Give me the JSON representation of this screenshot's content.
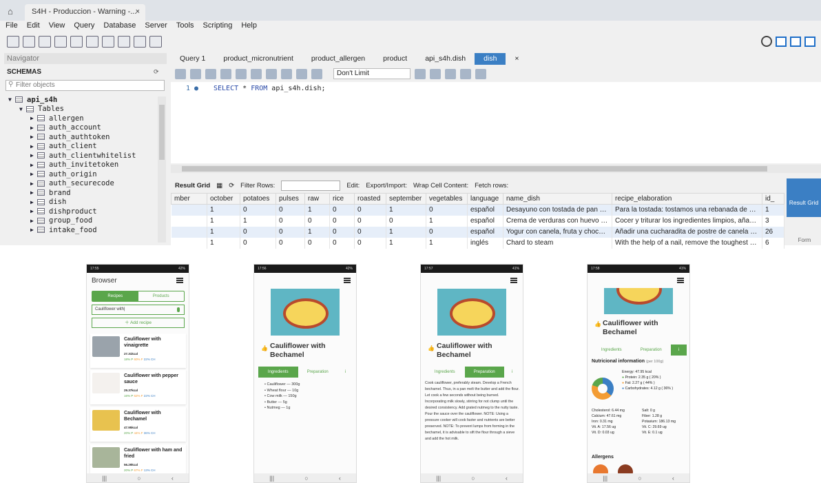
{
  "workbench": {
    "window_tab": "S4H - Produccion - Warning -...",
    "menu": [
      "File",
      "Edit",
      "View",
      "Query",
      "Database",
      "Server",
      "Tools",
      "Scripting",
      "Help"
    ],
    "navigator_label": "Navigator",
    "schemas_label": "SCHEMAS",
    "filter_placeholder": "Filter objects",
    "schema": "api_s4h",
    "tables_label": "Tables",
    "tables": [
      "allergen",
      "auth_account",
      "auth_authtoken",
      "auth_client",
      "auth_clientwhitelist",
      "auth_invitetoken",
      "auth_origin",
      "auth_securecode",
      "brand",
      "dish",
      "dishproduct",
      "group_food",
      "intake_food"
    ],
    "query_tabs": [
      "Query 1",
      "product_micronutrient",
      "product_allergen",
      "product",
      "api_s4h.dish",
      "dish"
    ],
    "limit_label": "Don't Limit",
    "line_no": "1",
    "sql": {
      "k1": "SELECT",
      "star": " * ",
      "k2": "FROM",
      "rest": " api_s4h.dish;"
    },
    "grid_toolbar": {
      "result_grid": "Result Grid",
      "filter_rows": "Filter Rows:",
      "edit": "Edit:",
      "export": "Export/Import:",
      "wrap": "Wrap Cell Content:",
      "fetch": "Fetch rows:"
    },
    "side_buttons": {
      "result_grid": "Result Grid",
      "form": "Form"
    },
    "columns": [
      "mber",
      "october",
      "potatoes",
      "pulses",
      "raw",
      "rice",
      "roasted",
      "september",
      "vegetables",
      "language",
      "name_dish",
      "recipe_elaboration",
      "id_"
    ],
    "rows": [
      [
        "",
        "1",
        "0",
        "0",
        "1",
        "0",
        "0",
        "1",
        "0",
        "español",
        "Desayuno con tostada de pan d...",
        "Para la tostada: tostamos una rebanada de pan...",
        "1"
      ],
      [
        "",
        "1",
        "1",
        "0",
        "0",
        "0",
        "0",
        "0",
        "1",
        "español",
        "Crema de verduras con huevo y ...",
        "Cocer y triturar los ingredientes limpios, añadie...",
        "3"
      ],
      [
        "",
        "1",
        "0",
        "0",
        "1",
        "0",
        "0",
        "1",
        "0",
        "español",
        "Yogur con canela, fruta y chocol...",
        "Añadir una cucharadita de postre de canela en ...",
        "26"
      ],
      [
        "",
        "1",
        "0",
        "0",
        "0",
        "0",
        "0",
        "1",
        "1",
        "inglés",
        "Chard to steam",
        "With the help of a nail, remove the toughest str...",
        "6"
      ]
    ]
  },
  "phones": {
    "p1": {
      "status_time": "17:55",
      "status_right": "42%",
      "title": "Browser",
      "tab_recipes": "Recipes",
      "tab_products": "Products",
      "search_value": "Cauliflower with|",
      "add_recipe": "Add recipe",
      "cards": [
        {
          "name": "Cauliflower with vinaigrette",
          "kcal": "27.31kcal",
          "p": "18% P",
          "f": "60% F",
          "c": "22% CH"
        },
        {
          "name": "Cauliflower with pepper sauce",
          "kcal": "29.37kcal",
          "p": "16% P",
          "f": "62% F",
          "c": "22% CH"
        },
        {
          "name": "Cauliflower with Bechamel",
          "kcal": "47.95kcal",
          "p": "20% P",
          "f": "44% F",
          "c": "36% CH"
        },
        {
          "name": "Cauliflower with ham and fried",
          "kcal": "56.29kcal",
          "p": "20% P",
          "f": "67% F",
          "c": "13% CH"
        }
      ]
    },
    "p2": {
      "status_time": "17:56",
      "status_right": "42%",
      "recipe_title": "Cauliflower with Bechamel",
      "tab_ingredients": "Ingredients",
      "tab_preparation": "Preparation",
      "tab_info": "i",
      "ingredients": [
        "Cauliflower — 300g",
        "Wheat flour — 10g",
        "Cow milk — 150g",
        "Butter — 5g",
        "Nutmeg — 1g"
      ]
    },
    "p3": {
      "status_time": "17:57",
      "status_right": "41%",
      "recipe_title": "Cauliflower with Bechamel",
      "tab_ingredients": "Ingredients",
      "tab_preparation": "Preparation",
      "tab_info": "i",
      "preparation": "Cook cauliflower, preferably steam. Develop a French bechamel. Thus, in a pan melt the butter and add the flour. Let cook a few seconds without being burned. Incorporating milk slowly, stirring for not clump until the desired consistency. Add grated nutmeg to the nutty taste. Pour the sauce over the cauliflower. NOTE: Using a pressure cooker will cook faster and nutrients are better preserved. NOTE: To prevent lumps from forming in the bechamel, it is advisable to sift the flour through a sieve and add the hot milk."
    },
    "p4": {
      "status_time": "17:58",
      "status_right": "41%",
      "recipe_title": "Cauliflower with Bechamel",
      "tab_ingredients": "Ingredients",
      "tab_preparation": "Preparation",
      "tab_info": "i",
      "nutri_title": "Nutricional information",
      "nutri_sub": "(per 100g)",
      "energy": "Energy: 47.95 kcal",
      "protein": "Protein: 2.35 g ( 20% )",
      "fat": "Fat: 2.27 g ( 44% )",
      "carbs": "Carbohydrates: 4.12 g ( 36% )",
      "minerals": [
        "Cholesterol: 6.44 mg",
        "Salt: 0 g",
        "Calcium: 47.61 mg",
        "Fiber: 1.28 g",
        "Iron: 0.31 mg",
        "Potasium: 186.13 mg",
        "Vit. A: 17.56 ug",
        "Vit. C: 29.69 ug",
        "Vit. D: 0.03 ug",
        "Vit. E: 0.1 ug"
      ],
      "allergens_title": "Allergens"
    }
  },
  "colors": {
    "green": "#5aa64b",
    "blue": "#3b7fc4",
    "orange": "#f39c34"
  }
}
